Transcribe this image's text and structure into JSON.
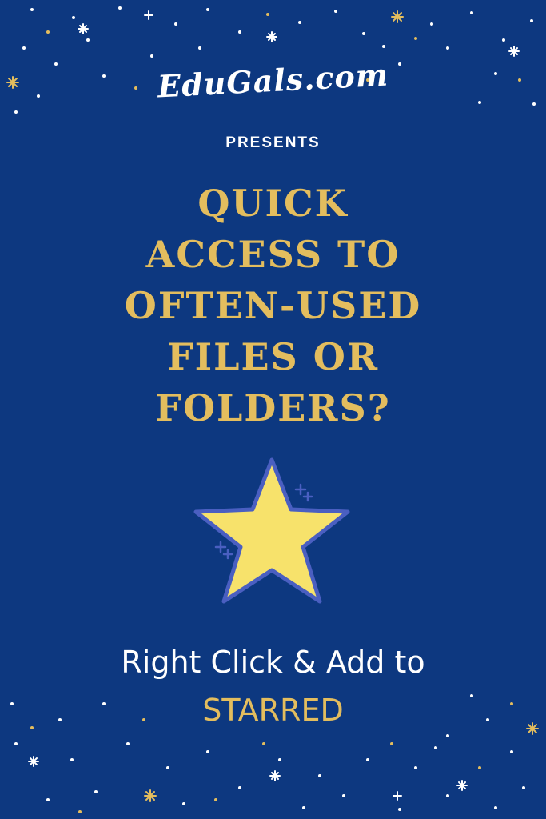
{
  "logo_text": "EduGals.com",
  "presents": "PRESENTS",
  "headline": {
    "lines": [
      "QUICK",
      "ACCESS TO",
      "OFTEN-USED",
      "FILES OR",
      "FOLDERS?"
    ]
  },
  "cta": {
    "line1": "Right Click & Add to",
    "line2": "STARRED"
  },
  "icons": {
    "main": "star-icon",
    "accent": "plus-sparkle-icon"
  },
  "colors": {
    "background": "#0d3880",
    "headline": "#e3bd5e",
    "star_fill": "#f7e26b",
    "star_outline": "#4a5fc1",
    "text": "#ffffff"
  }
}
